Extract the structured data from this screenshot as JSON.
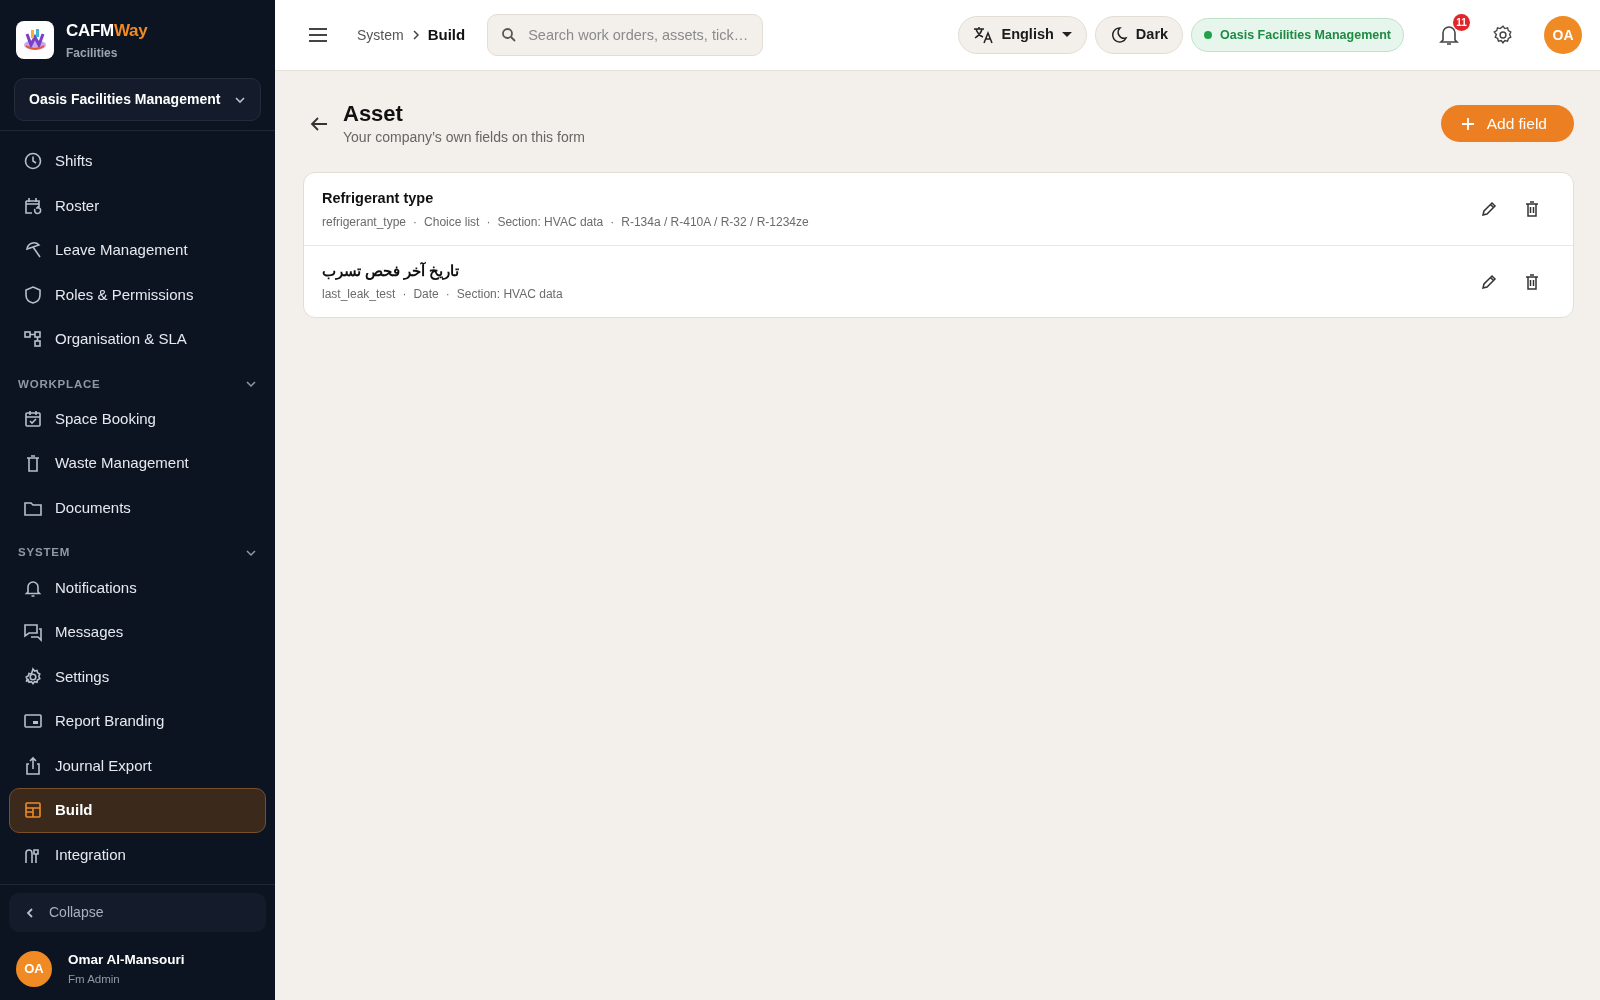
{
  "brand": {
    "name_main": "CAFM",
    "name_accent": "Way",
    "subtitle": "Facilities"
  },
  "org_selector": {
    "value": "Oasis Facilities Management"
  },
  "sidebar": {
    "groups": [
      {
        "items": [
          {
            "label": "Shifts",
            "selected": false
          },
          {
            "label": "Roster",
            "selected": false
          },
          {
            "label": "Leave Management",
            "selected": false
          },
          {
            "label": "Roles & Permissions",
            "selected": false
          },
          {
            "label": "Organisation & SLA",
            "selected": false
          }
        ]
      },
      {
        "heading": "WORKPLACE",
        "expanded": true,
        "items": [
          {
            "label": "Space Booking",
            "selected": false
          },
          {
            "label": "Waste Management",
            "selected": false
          },
          {
            "label": "Documents",
            "selected": false
          }
        ]
      },
      {
        "heading": "SYSTEM",
        "expanded": true,
        "items": [
          {
            "label": "Notifications",
            "selected": false
          },
          {
            "label": "Messages",
            "selected": false
          },
          {
            "label": "Settings",
            "selected": false
          },
          {
            "label": "Report Branding",
            "selected": false
          },
          {
            "label": "Journal Export",
            "selected": false
          },
          {
            "label": "Build",
            "selected": true
          },
          {
            "label": "Integration",
            "selected": false
          }
        ]
      }
    ],
    "collapse_label": "Collapse"
  },
  "user": {
    "initials": "OA",
    "name": "Omar Al-Mansouri",
    "role": "Fm Admin"
  },
  "topbar": {
    "breadcrumb": [
      {
        "label": "System",
        "current": false
      },
      {
        "label": "Build",
        "current": true
      }
    ],
    "search": {
      "placeholder": "Search work orders, assets, tick…"
    },
    "language": "English",
    "theme_label": "Dark",
    "org_status": "Oasis Facilities Management",
    "notifications_count": "11",
    "avatar_initials": "OA"
  },
  "page": {
    "title": "Asset",
    "subtitle": "Your company’s own fields on this form",
    "add_button": "Add field"
  },
  "fields": [
    {
      "label": "Refrigerant type",
      "meta": [
        "refrigerant_type",
        "Choice list",
        "Section: HVAC data",
        "R-134a / R-410A / R-32 / R-1234ze"
      ]
    },
    {
      "label": "تاريخ آخر فحص تسرب",
      "meta": [
        "last_leak_test",
        "Date",
        "Section: HVAC data"
      ]
    }
  ],
  "meta_separator": "·"
}
